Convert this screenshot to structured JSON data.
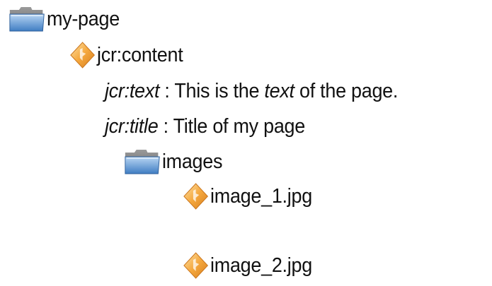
{
  "tree": {
    "root": {
      "label": "my-page",
      "icon": "folder-icon"
    },
    "content_node": {
      "label": "jcr:content",
      "icon": "node-diamond-icon"
    },
    "properties": {
      "text": {
        "name": "jcr:text",
        "separator": " : This is the ",
        "emphasis": "text",
        "tail": " of the page."
      },
      "title": {
        "name": "jcr:title",
        "value": " : Title of my page"
      }
    },
    "images_folder": {
      "label": "images",
      "icon": "folder-icon"
    },
    "image_1": {
      "label": "image_1.jpg",
      "icon": "node-diamond-icon"
    },
    "image_2": {
      "label": "image_2.jpg",
      "icon": "node-diamond-icon"
    }
  },
  "colors": {
    "folder_blue": "#4a86c8",
    "folder_light": "#9cc3ee",
    "folder_tab": "#7f7f7f",
    "diamond_orange": "#f3a43c",
    "diamond_light": "#fcd58f",
    "diamond_dark": "#c9741b"
  }
}
